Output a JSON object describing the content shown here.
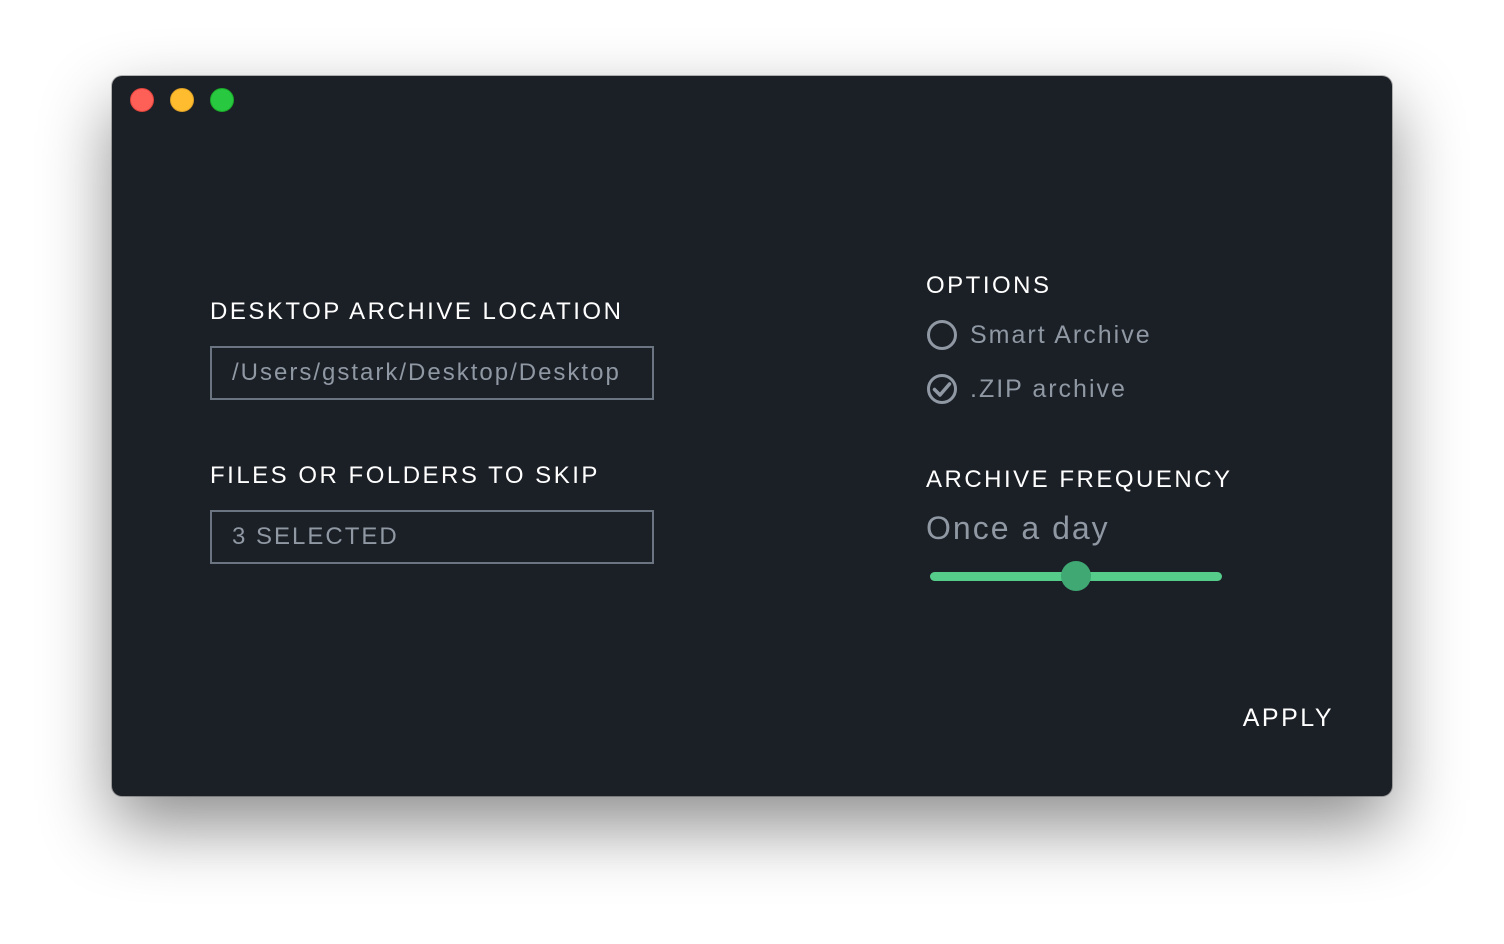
{
  "window": {
    "controls": {
      "close_color": "#fe5f57",
      "minimize_color": "#febc2e",
      "zoom_color": "#28c840"
    }
  },
  "left": {
    "archive_location": {
      "label": "DESKTOP ARCHIVE LOCATION",
      "value": "/Users/gstark/Desktop/Desktop"
    },
    "skip": {
      "label": "FILES OR FOLDERS TO SKIP",
      "value": "3 SELECTED"
    }
  },
  "right": {
    "options": {
      "label": "OPTIONS",
      "items": [
        {
          "label": "Smart Archive",
          "checked": false,
          "icon": "radio-empty-icon"
        },
        {
          "label": ".ZIP archive",
          "checked": true,
          "icon": "radio-checked-icon"
        }
      ]
    },
    "frequency": {
      "label": "ARCHIVE FREQUENCY",
      "value": "Once a day",
      "slider_level": 0.5,
      "accent": "#56cc8a"
    }
  },
  "footer": {
    "apply_label": "APPLY"
  }
}
